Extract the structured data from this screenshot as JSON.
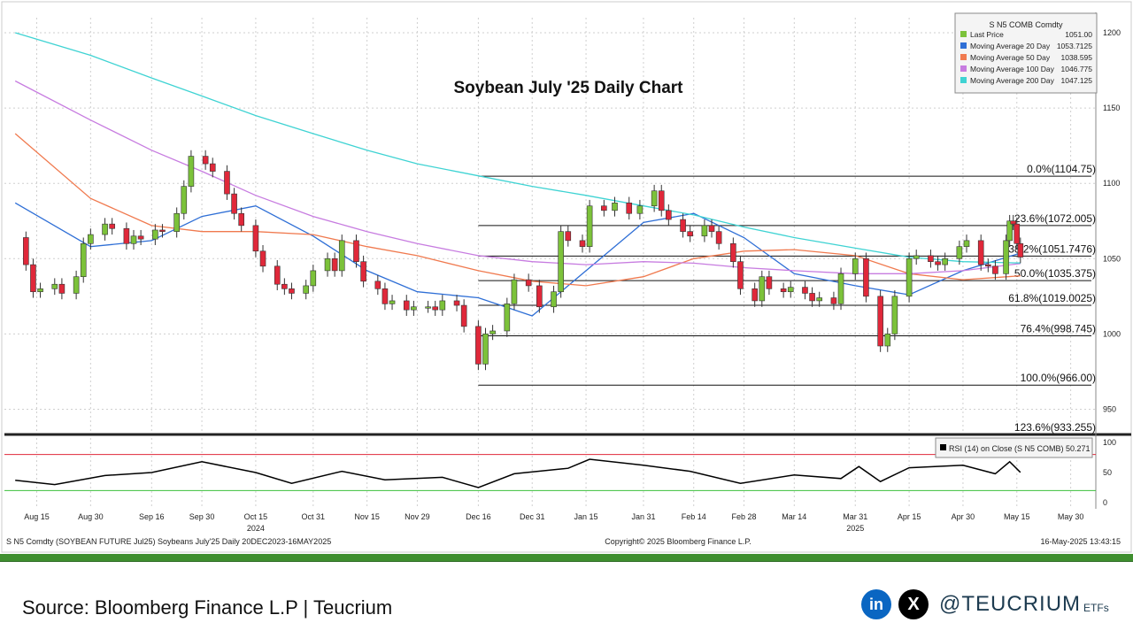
{
  "title": "Soybean July '25 Daily Chart",
  "legend": {
    "header": "S N5 COMB Comdty",
    "items": [
      {
        "label": "Last Price",
        "value": "1051.00",
        "color": "#7cc23a"
      },
      {
        "label": "Moving Average 20 Day",
        "value": "1053.7125",
        "color": "#2f6fd6"
      },
      {
        "label": "Moving Average 50 Day",
        "value": "1038.595",
        "color": "#f07a4f"
      },
      {
        "label": "Moving Average 100 Day",
        "value": "1046.775",
        "color": "#c77ce0"
      },
      {
        "label": "Moving Average 200 Day",
        "value": "1047.125",
        "color": "#3fd3d3"
      }
    ]
  },
  "rsi_legend": "RSI (14)   on Close (S N5 COMB) 50.271",
  "footer": {
    "left": "S N5 Comdty (SOYBEAN FUTURE   Jul25) Soybeans July'25  Daily 20DEC2023-16MAY2025",
    "center": "Copyright© 2025 Bloomberg Finance L.P.",
    "right": "16-May-2025 13:43:15"
  },
  "source": "Source: Bloomberg Finance L.P | Teucrium",
  "social": {
    "linkedin_icon": "in",
    "x_icon": "X",
    "handle": "@TEUCRIUM",
    "suffix": "ETFs"
  },
  "chart_data": {
    "type": "candlestick",
    "title": "Soybean July '25 Daily Chart",
    "price_axis": {
      "ticks": [
        950,
        1000,
        1050,
        1100,
        1150,
        1200
      ],
      "range": [
        935,
        1210
      ]
    },
    "rsi_axis": {
      "ticks": [
        0,
        50,
        100
      ],
      "overbought": 80,
      "oversold": 20
    },
    "x_ticks": [
      {
        "label": "Aug 15",
        "date": "2024-08-15"
      },
      {
        "label": "Aug 30",
        "date": "2024-08-30"
      },
      {
        "label": "Sep 16",
        "date": "2024-09-16"
      },
      {
        "label": "Sep 30",
        "date": "2024-09-30"
      },
      {
        "label": "Oct 15",
        "date": "2024-10-15"
      },
      {
        "label": "Oct 31",
        "date": "2024-10-31"
      },
      {
        "label": "Nov 15",
        "date": "2024-11-15"
      },
      {
        "label": "Nov 29",
        "date": "2024-11-29"
      },
      {
        "label": "Dec 16",
        "date": "2024-12-16"
      },
      {
        "label": "Dec 31",
        "date": "2024-12-31"
      },
      {
        "label": "Jan 15",
        "date": "2025-01-15"
      },
      {
        "label": "Jan 31",
        "date": "2025-01-31"
      },
      {
        "label": "Feb 14",
        "date": "2025-02-14"
      },
      {
        "label": "Feb 28",
        "date": "2025-02-28"
      },
      {
        "label": "Mar 14",
        "date": "2025-03-14"
      },
      {
        "label": "Mar 31",
        "date": "2025-03-31"
      },
      {
        "label": "Apr 15",
        "date": "2025-04-15"
      },
      {
        "label": "Apr 30",
        "date": "2025-04-30"
      },
      {
        "label": "May 15",
        "date": "2025-05-15"
      },
      {
        "label": "May 30",
        "date": "2025-05-30"
      }
    ],
    "year_labels": [
      {
        "label": "2024",
        "date": "2024-10-15"
      },
      {
        "label": "2025",
        "date": "2025-03-31"
      }
    ],
    "close_series": [
      [
        "2024-08-09",
        1064
      ],
      [
        "2024-08-12",
        1046
      ],
      [
        "2024-08-14",
        1028
      ],
      [
        "2024-08-16",
        1030
      ],
      [
        "2024-08-20",
        1033
      ],
      [
        "2024-08-22",
        1027
      ],
      [
        "2024-08-26",
        1038
      ],
      [
        "2024-08-28",
        1060
      ],
      [
        "2024-08-30",
        1066
      ],
      [
        "2024-09-03",
        1073
      ],
      [
        "2024-09-05",
        1070
      ],
      [
        "2024-09-09",
        1060
      ],
      [
        "2024-09-11",
        1065
      ],
      [
        "2024-09-13",
        1063
      ],
      [
        "2024-09-17",
        1069
      ],
      [
        "2024-09-19",
        1068
      ],
      [
        "2024-09-23",
        1080
      ],
      [
        "2024-09-25",
        1098
      ],
      [
        "2024-09-27",
        1118
      ],
      [
        "2024-10-01",
        1113
      ],
      [
        "2024-10-03",
        1108
      ],
      [
        "2024-10-07",
        1093
      ],
      [
        "2024-10-09",
        1080
      ],
      [
        "2024-10-11",
        1072
      ],
      [
        "2024-10-15",
        1055
      ],
      [
        "2024-10-17",
        1045
      ],
      [
        "2024-10-21",
        1033
      ],
      [
        "2024-10-23",
        1030
      ],
      [
        "2024-10-25",
        1027
      ],
      [
        "2024-10-29",
        1032
      ],
      [
        "2024-10-31",
        1042
      ],
      [
        "2024-11-04",
        1050
      ],
      [
        "2024-11-06",
        1042
      ],
      [
        "2024-11-08",
        1062
      ],
      [
        "2024-11-12",
        1048
      ],
      [
        "2024-11-14",
        1035
      ],
      [
        "2024-11-18",
        1030
      ],
      [
        "2024-11-20",
        1020
      ],
      [
        "2024-11-22",
        1022
      ],
      [
        "2024-11-26",
        1016
      ],
      [
        "2024-11-28",
        1018
      ],
      [
        "2024-12-02",
        1018
      ],
      [
        "2024-12-04",
        1016
      ],
      [
        "2024-12-06",
        1022
      ],
      [
        "2024-12-10",
        1019
      ],
      [
        "2024-12-12",
        1005
      ],
      [
        "2024-12-16",
        980
      ],
      [
        "2024-12-18",
        1000
      ],
      [
        "2024-12-20",
        1002
      ],
      [
        "2024-12-24",
        1020
      ],
      [
        "2024-12-26",
        1036
      ],
      [
        "2024-12-30",
        1032
      ],
      [
        "2025-01-02",
        1018
      ],
      [
        "2025-01-06",
        1028
      ],
      [
        "2025-01-08",
        1068
      ],
      [
        "2025-01-10",
        1062
      ],
      [
        "2025-01-14",
        1058
      ],
      [
        "2025-01-16",
        1085
      ],
      [
        "2025-01-20",
        1082
      ],
      [
        "2025-01-23",
        1087
      ],
      [
        "2025-01-27",
        1080
      ],
      [
        "2025-01-30",
        1085
      ],
      [
        "2025-02-03",
        1095
      ],
      [
        "2025-02-05",
        1082
      ],
      [
        "2025-02-07",
        1076
      ],
      [
        "2025-02-11",
        1068
      ],
      [
        "2025-02-13",
        1065
      ],
      [
        "2025-02-17",
        1072
      ],
      [
        "2025-02-19",
        1068
      ],
      [
        "2025-02-21",
        1060
      ],
      [
        "2025-02-25",
        1048
      ],
      [
        "2025-02-27",
        1030
      ],
      [
        "2025-03-03",
        1022
      ],
      [
        "2025-03-05",
        1038
      ],
      [
        "2025-03-07",
        1030
      ],
      [
        "2025-03-11",
        1028
      ],
      [
        "2025-03-13",
        1031
      ],
      [
        "2025-03-17",
        1027
      ],
      [
        "2025-03-19",
        1022
      ],
      [
        "2025-03-21",
        1024
      ],
      [
        "2025-03-25",
        1020
      ],
      [
        "2025-03-27",
        1040
      ],
      [
        "2025-03-31",
        1050
      ],
      [
        "2025-04-03",
        1025
      ],
      [
        "2025-04-07",
        992
      ],
      [
        "2025-04-09",
        1000
      ],
      [
        "2025-04-11",
        1025
      ],
      [
        "2025-04-15",
        1050
      ],
      [
        "2025-04-17",
        1052
      ],
      [
        "2025-04-21",
        1048
      ],
      [
        "2025-04-23",
        1046
      ],
      [
        "2025-04-25",
        1050
      ],
      [
        "2025-04-29",
        1058
      ],
      [
        "2025-05-01",
        1062
      ],
      [
        "2025-05-05",
        1046
      ],
      [
        "2025-05-07",
        1045
      ],
      [
        "2025-05-09",
        1040
      ],
      [
        "2025-05-12",
        1062
      ],
      [
        "2025-05-13",
        1075
      ],
      [
        "2025-05-14",
        1073
      ],
      [
        "2025-05-15",
        1060
      ],
      [
        "2025-05-16",
        1051
      ]
    ],
    "moving_averages": [
      {
        "name": "Moving Average 20 Day",
        "color": "#2f6fd6",
        "points": [
          [
            "2024-08-09",
            1087
          ],
          [
            "2024-08-30",
            1058
          ],
          [
            "2024-09-16",
            1062
          ],
          [
            "2024-09-30",
            1078
          ],
          [
            "2024-10-15",
            1085
          ],
          [
            "2024-10-31",
            1065
          ],
          [
            "2024-11-15",
            1042
          ],
          [
            "2024-11-29",
            1028
          ],
          [
            "2024-12-16",
            1024
          ],
          [
            "2024-12-31",
            1012
          ],
          [
            "2025-01-15",
            1042
          ],
          [
            "2025-01-31",
            1074
          ],
          [
            "2025-02-14",
            1080
          ],
          [
            "2025-02-28",
            1064
          ],
          [
            "2025-03-14",
            1040
          ],
          [
            "2025-03-31",
            1032
          ],
          [
            "2025-04-15",
            1026
          ],
          [
            "2025-04-30",
            1042
          ],
          [
            "2025-05-16",
            1053.7125
          ]
        ]
      },
      {
        "name": "Moving Average 50 Day",
        "color": "#f07a4f",
        "points": [
          [
            "2024-08-09",
            1133
          ],
          [
            "2024-08-30",
            1090
          ],
          [
            "2024-09-16",
            1072
          ],
          [
            "2024-09-30",
            1068
          ],
          [
            "2024-10-15",
            1068
          ],
          [
            "2024-10-31",
            1066
          ],
          [
            "2024-11-15",
            1058
          ],
          [
            "2024-11-29",
            1052
          ],
          [
            "2024-12-16",
            1042
          ],
          [
            "2024-12-31",
            1035
          ],
          [
            "2025-01-15",
            1032
          ],
          [
            "2025-01-31",
            1038
          ],
          [
            "2025-02-14",
            1050
          ],
          [
            "2025-02-28",
            1055
          ],
          [
            "2025-03-14",
            1056
          ],
          [
            "2025-03-31",
            1052
          ],
          [
            "2025-04-15",
            1040
          ],
          [
            "2025-04-30",
            1036
          ],
          [
            "2025-05-16",
            1038.595
          ]
        ]
      },
      {
        "name": "Moving Average 100 Day",
        "color": "#c77ce0",
        "points": [
          [
            "2024-08-09",
            1168
          ],
          [
            "2024-08-30",
            1142
          ],
          [
            "2024-09-16",
            1122
          ],
          [
            "2024-09-30",
            1108
          ],
          [
            "2024-10-15",
            1092
          ],
          [
            "2024-10-31",
            1078
          ],
          [
            "2024-11-15",
            1068
          ],
          [
            "2024-11-29",
            1060
          ],
          [
            "2024-12-16",
            1052
          ],
          [
            "2024-12-31",
            1048
          ],
          [
            "2025-01-15",
            1046
          ],
          [
            "2025-01-31",
            1048
          ],
          [
            "2025-02-14",
            1047
          ],
          [
            "2025-02-28",
            1044
          ],
          [
            "2025-03-14",
            1042
          ],
          [
            "2025-03-31",
            1040
          ],
          [
            "2025-04-15",
            1040
          ],
          [
            "2025-04-30",
            1042
          ],
          [
            "2025-05-16",
            1046.775
          ]
        ]
      },
      {
        "name": "Moving Average 200 Day",
        "color": "#3fd3d3",
        "points": [
          [
            "2024-08-09",
            1200
          ],
          [
            "2024-08-30",
            1185
          ],
          [
            "2024-09-16",
            1170
          ],
          [
            "2024-09-30",
            1158
          ],
          [
            "2024-10-15",
            1145
          ],
          [
            "2024-10-31",
            1133
          ],
          [
            "2024-11-15",
            1122
          ],
          [
            "2024-11-29",
            1113
          ],
          [
            "2024-12-16",
            1105
          ],
          [
            "2024-12-31",
            1098
          ],
          [
            "2025-01-15",
            1092
          ],
          [
            "2025-01-31",
            1085
          ],
          [
            "2025-02-14",
            1079
          ],
          [
            "2025-02-28",
            1071
          ],
          [
            "2025-03-14",
            1064
          ],
          [
            "2025-03-31",
            1057
          ],
          [
            "2025-04-15",
            1051
          ],
          [
            "2025-04-30",
            1048
          ],
          [
            "2025-05-16",
            1047.125
          ]
        ]
      }
    ],
    "fibonacci": {
      "start_date": "2024-12-16",
      "levels": [
        {
          "label": "0.0%(1104.75)",
          "value": 1104.75
        },
        {
          "label": "23.6%(1072.005)",
          "value": 1072.005
        },
        {
          "label": "38.2%(1051.7476)",
          "value": 1051.7476
        },
        {
          "label": "50.0%(1035.375)",
          "value": 1035.375
        },
        {
          "label": "61.8%(1019.0025)",
          "value": 1019.0025
        },
        {
          "label": "76.4%(998.745)",
          "value": 998.745
        },
        {
          "label": "100.0%(966.00)",
          "value": 966.0
        },
        {
          "label": "123.6%(933.255)",
          "value": 933.255
        }
      ]
    },
    "rsi": [
      [
        "2024-08-09",
        37
      ],
      [
        "2024-08-20",
        30
      ],
      [
        "2024-09-03",
        45
      ],
      [
        "2024-09-16",
        50
      ],
      [
        "2024-09-30",
        68
      ],
      [
        "2024-10-15",
        50
      ],
      [
        "2024-10-25",
        32
      ],
      [
        "2024-11-08",
        52
      ],
      [
        "2024-11-20",
        38
      ],
      [
        "2024-12-06",
        42
      ],
      [
        "2024-12-16",
        25
      ],
      [
        "2024-12-26",
        48
      ],
      [
        "2025-01-10",
        57
      ],
      [
        "2025-01-16",
        72
      ],
      [
        "2025-01-31",
        62
      ],
      [
        "2025-02-13",
        52
      ],
      [
        "2025-02-27",
        32
      ],
      [
        "2025-03-14",
        46
      ],
      [
        "2025-03-27",
        40
      ],
      [
        "2025-04-01",
        60
      ],
      [
        "2025-04-07",
        35
      ],
      [
        "2025-04-15",
        58
      ],
      [
        "2025-04-30",
        62
      ],
      [
        "2025-05-09",
        48
      ],
      [
        "2025-05-13",
        68
      ],
      [
        "2025-05-16",
        50.271
      ]
    ]
  }
}
